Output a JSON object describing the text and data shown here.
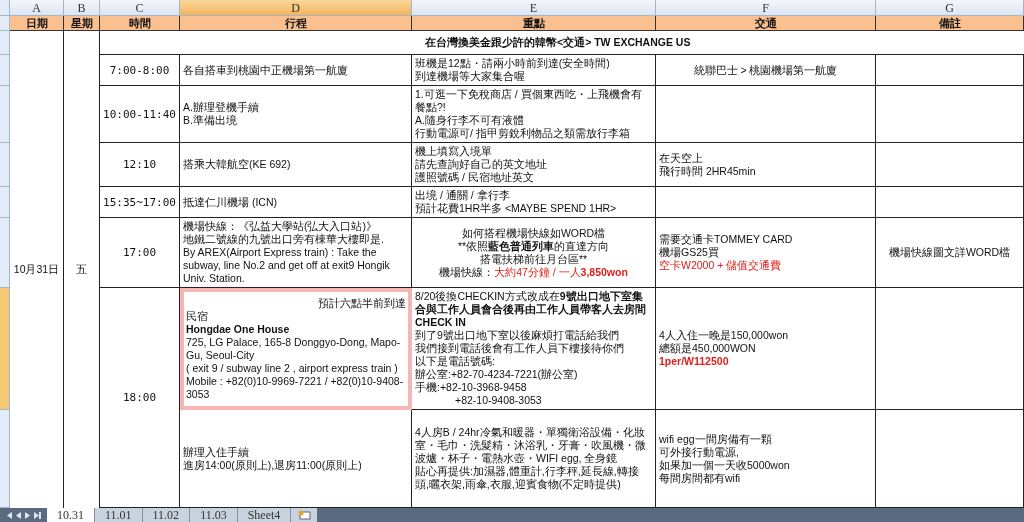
{
  "column_headers": [
    {
      "label": "A",
      "selected": false
    },
    {
      "label": "B",
      "selected": false
    },
    {
      "label": "C",
      "selected": false
    },
    {
      "label": "D",
      "selected": true
    },
    {
      "label": "E",
      "selected": false
    },
    {
      "label": "F",
      "selected": false
    },
    {
      "label": "G",
      "selected": false
    }
  ],
  "header_row": [
    "日期",
    "星期",
    "時間",
    "行程",
    "重點",
    "交通",
    "備註"
  ],
  "date": "10月31日",
  "weekday": "五",
  "banner": "在台灣換美金跟少許的韓幣<交通> TW EXCHANGE US",
  "rows": [
    {
      "selected": false,
      "time": "7:00-8:00",
      "itinerary": [
        "各自搭車到桃園中正機場第一航廈"
      ],
      "notes": [
        "班機是12點・請兩小時前到達(安全時間)",
        "到達機場等大家集合喔"
      ],
      "transport": [
        "統聯巴士 > 桃園機場第一航廈"
      ],
      "remarks": []
    },
    {
      "selected": false,
      "time": "10:00-11:40",
      "itinerary": [
        "A.辦理登機手續",
        "B.準備出境"
      ],
      "notes": [
        "1.可逛一下免稅商店 / 買個東西吃・上飛機會有餐點?!",
        "A.隨身行李不可有液體",
        "行動電源可/ 指甲剪銳利物品之類需放行李箱"
      ],
      "transport": [],
      "remarks": []
    },
    {
      "selected": false,
      "time": "12:10",
      "itinerary": [
        "搭乘大韓航空(KE 692)"
      ],
      "notes": [
        "機上填寫入境單",
        "請先查詢好自己的英文地址",
        "護照號碼 / 民宿地址英文"
      ],
      "transport": [
        "在天空上",
        "飛行時間 2HR45min"
      ],
      "remarks": []
    },
    {
      "selected": false,
      "time": "15:35~17:00",
      "itinerary": [
        "抵達仁川機場 (ICN)"
      ],
      "notes": [
        "出境 / 通關 / 拿行李",
        "預計花費1HR半多 <MAYBE SPEND 1HR>"
      ],
      "transport": [],
      "remarks": []
    },
    {
      "selected": false,
      "time": "17:00",
      "itinerary": [
        "機場快線：《弘益大學站(弘大入口站)》",
        "地鐵二號線的九號出口旁有棟華大樓即是.",
        "By AREX(Airport Express train) : Take the subway, line No.2 and get off at exit9 Hongik Univ. Station."
      ],
      "notes": [
        "如何搭程機場快線如WORD檔",
        {
          "parts": [
            {
              "text": "**依照",
              "kind": "normal"
            },
            {
              "text": "藍色普通列車",
              "kind": "emphasis"
            },
            {
              "text": "的直達方向",
              "kind": "normal"
            }
          ]
        },
        "搭電扶梯前往月台區**",
        {
          "parts": [
            {
              "text": "機場快線：",
              "kind": "normal"
            },
            {
              "text": "大約47分鐘 / 一人",
              "kind": "warning"
            },
            {
              "text": "3,850won",
              "kind": "warning-strong"
            }
          ]
        }
      ],
      "transport": [
        "需要交通卡TOMMEY CARD",
        "機場GS25買",
        {
          "text": "空卡W2000 + 儲值交通費",
          "kind": "warning"
        }
      ],
      "remarks": [
        "機場快線圖文詳WORD檔"
      ]
    },
    {
      "selected": true,
      "time": "18:00",
      "itinerary": [
        {
          "text": "預計六點半前到達",
          "kind": "note"
        },
        "民宿",
        {
          "text": "Hongdae One House",
          "kind": "emphasis"
        },
        "725, LG Palace, 165-8 Donggyo-Dong, Mapo-Gu, Seoul-City",
        "( exit 9 / subway line 2 , airport express train )",
        "Mobile : +82(0)10-9969-7221 / +82(0)10-9408-3053"
      ],
      "notes": [
        "8/20後換CHECKIN方式改成在**9號出口地下室集合與工作人員會合後再由工作人員帶客人去房間CHECK IN**",
        "到了9號出口地下室以後麻煩打電話給我們",
        "我們接到電話後會有工作人員下樓接待你們",
        "以下是電話號碼:",
        "辦公室:+82-70-4234-7221(辦公室)",
        "手機:+82-10-3968-9458",
        {
          "text": "+82-10-9408-3053",
          "kind": "continuation"
        }
      ],
      "transport": [
        "4人入住一晚是150,000won",
        "總額是450,000WON",
        {
          "text": "1per/W112500",
          "kind": "warning-strong"
        }
      ],
      "remarks": []
    },
    {
      "selected": false,
      "itinerary": [
        "辦理入住手續",
        "進房14:00(原則上),退房11:00(原則上)"
      ],
      "notes": [
        "4人房B / 24hr冷氣和暖器・單獨衛浴設備・化妝室・毛巾・洗髮精・沐浴乳・牙膏・吹風機・微波爐・杯子・電熱水壺・WIFI egg, 全身鏡",
        "貼心再提供:加濕器,體重計,行李秤,延長線,轉接頭,曬衣架,雨傘,衣服,迎賓食物(不定時提供)"
      ],
      "transport": [
        "wifi egg一間房備有一顆",
        "可外接行動電源,",
        "如果加一個一天收5000won",
        "每間房間都有wifi"
      ],
      "remarks": []
    }
  ],
  "sheet_tabs": [
    {
      "label": "10.31",
      "selected": true
    },
    {
      "label": "11.01",
      "selected": false
    },
    {
      "label": "11.02",
      "selected": false
    },
    {
      "label": "11.03",
      "selected": false
    },
    {
      "label": "Sheet4",
      "selected": false
    }
  ]
}
